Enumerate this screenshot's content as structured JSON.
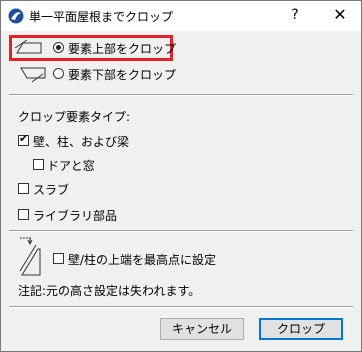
{
  "window": {
    "title": "単一平面屋根までクロップ",
    "help_label": "?",
    "close_label": "✕"
  },
  "crop_mode": {
    "options": [
      {
        "label": "要素上部をクロップ",
        "selected": true
      },
      {
        "label": "要素下部をクロップ",
        "selected": false
      }
    ]
  },
  "element_types": {
    "heading": "クロップ要素タイプ:",
    "items": [
      {
        "label": "壁、柱、および梁",
        "checked": true
      },
      {
        "label": "ドアと窓",
        "checked": false
      },
      {
        "label": "スラブ",
        "checked": false
      },
      {
        "label": "ライブラリ部品",
        "checked": false
      }
    ]
  },
  "top_setting": {
    "label": "壁/柱の上端を最高点に設定",
    "checked": false
  },
  "note": "注記:元の高さ設定は失われます。",
  "buttons": {
    "cancel": "キャンセル",
    "crop": "クロップ"
  },
  "colors": {
    "highlight": "#e8202a",
    "default_button_border": "#0078d7"
  }
}
